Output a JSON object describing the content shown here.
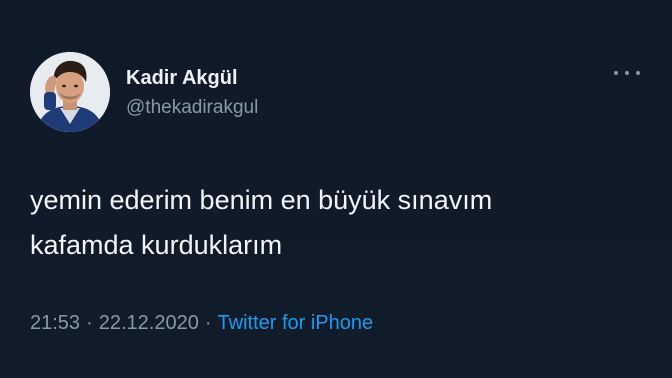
{
  "author": {
    "name": "Kadir Akgül",
    "handle": "@thekadirakgul"
  },
  "tweet": {
    "lines": [
      "yemin ederim benim en büyük sınavım",
      "kafamda kurduklarım"
    ]
  },
  "meta": {
    "time": "21:53",
    "date": "22.12.2020",
    "separator": "·",
    "source": "Twitter for iPhone"
  },
  "icons": {
    "more": "more-dots-icon",
    "avatar": "profile-photo"
  },
  "colors": {
    "background": "#101b29",
    "name": "#eef2f6",
    "secondary": "#8899a6",
    "link": "#1d9bf0"
  }
}
